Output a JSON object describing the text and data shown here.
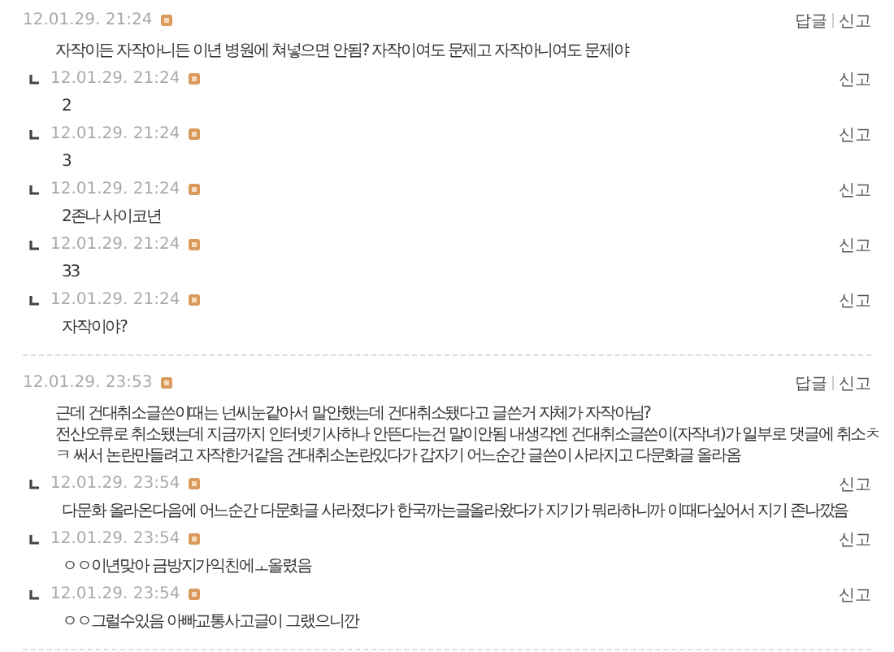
{
  "comments": [
    {
      "date": "12.01.29. 21:24",
      "lines": [
        "자작이든 자작아니든 이년 병원에 쳐넣으면 안됨? 자작이여도 문제고 자작아니여도 문제야"
      ],
      "actions": [
        "답글",
        "신고"
      ],
      "replies": [
        {
          "date": "12.01.29. 21:24",
          "text": "2",
          "actions": [
            "신고"
          ]
        },
        {
          "date": "12.01.29. 21:24",
          "text": "3",
          "actions": [
            "신고"
          ]
        },
        {
          "date": "12.01.29. 21:24",
          "text": "2존나 사이코년",
          "actions": [
            "신고"
          ]
        },
        {
          "date": "12.01.29. 21:24",
          "text": "33",
          "actions": [
            "신고"
          ]
        },
        {
          "date": "12.01.29. 21:24",
          "text": "자작이야?",
          "actions": [
            "신고"
          ]
        }
      ]
    },
    {
      "date": "12.01.29. 23:53",
      "lines": [
        "근데 건대취소글쓴이때는 넌씨눈같아서 말안했는데 건대취소됐다고 글쓴거 자체가 자작아님?",
        "전산오류로 취소됐는데 지금까지 인터넷기사하나 안뜬다는건 말이안됨 내생각엔 건대취소글쓴이(자작녀)가 일부로 댓글에 취소ㅊ",
        "ㅋ 써서 논란만들려고 자작한거같음 건대취소논란있다가 갑자기 어느순간 글쓴이 사라지고 다문화글 올라옴"
      ],
      "actions": [
        "답글",
        "신고"
      ],
      "replies": [
        {
          "date": "12.01.29. 23:54",
          "text": "다문화 올라온다음에 어느순간 다문화글 사라졌다가 한국까는글올라왔다가 지기가 뭐라하니까 이때다싶어서 지기 존나깠음",
          "actions": [
            "신고"
          ]
        },
        {
          "date": "12.01.29. 23:54",
          "text": "ㅇㅇ이년맞아 금방지가익친에ㅗ올렸음",
          "actions": [
            "신고"
          ]
        },
        {
          "date": "12.01.29. 23:54",
          "text": "ㅇㅇ그럴수있음 아빠교통사고글이 그랬으니깐",
          "actions": [
            "신고"
          ]
        }
      ]
    }
  ]
}
